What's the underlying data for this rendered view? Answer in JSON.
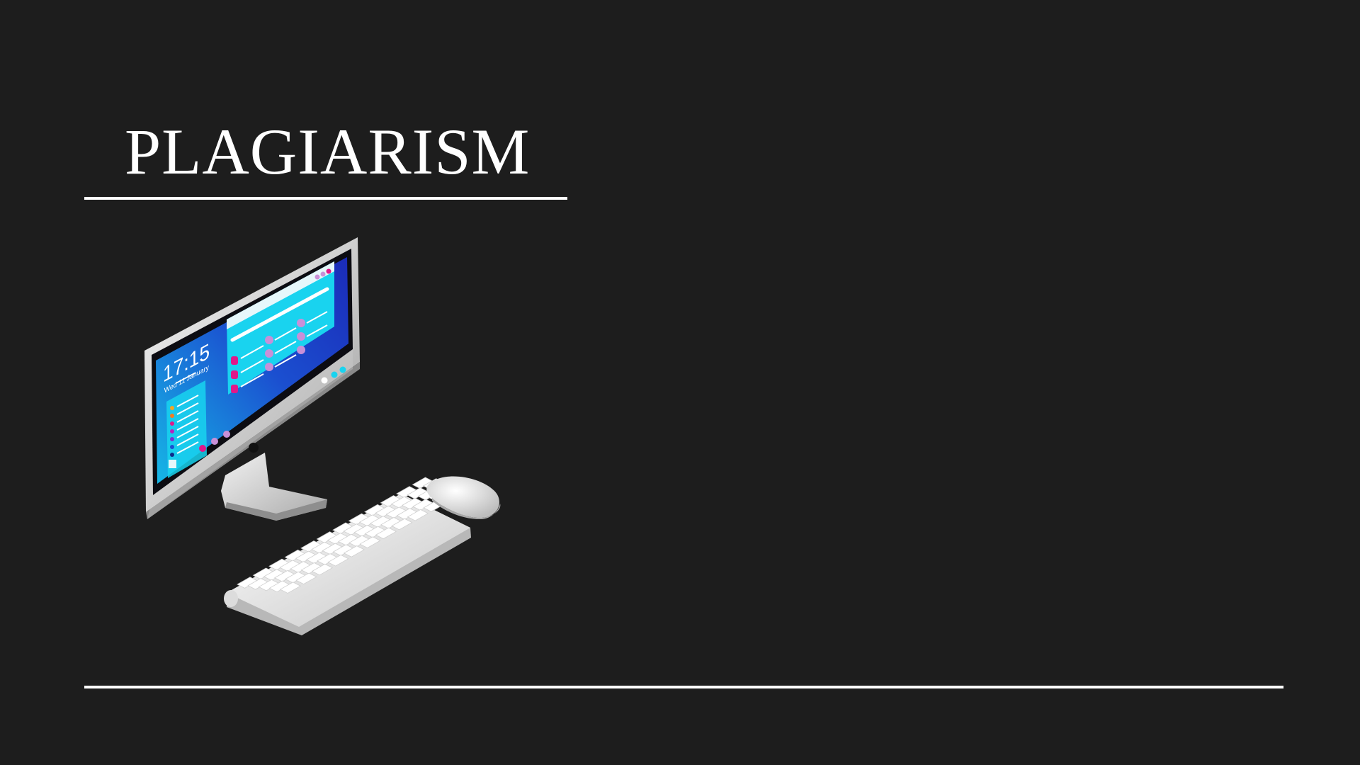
{
  "slide": {
    "title": "PLAGIARISM",
    "background_color": "#1d1d1d",
    "rule_color": "#ffffff"
  },
  "illustration": {
    "icon": "computer-desktop-icon",
    "screen": {
      "clock_time": "17:15",
      "clock_date": "Wed 11 January",
      "colors": {
        "screen_gradient_start": "#1b2bb8",
        "screen_gradient_end": "#16b8e6",
        "window_cyan": "#19d3ef",
        "accent_pink": "#e0188a",
        "accent_lilac": "#c890d8"
      }
    }
  }
}
